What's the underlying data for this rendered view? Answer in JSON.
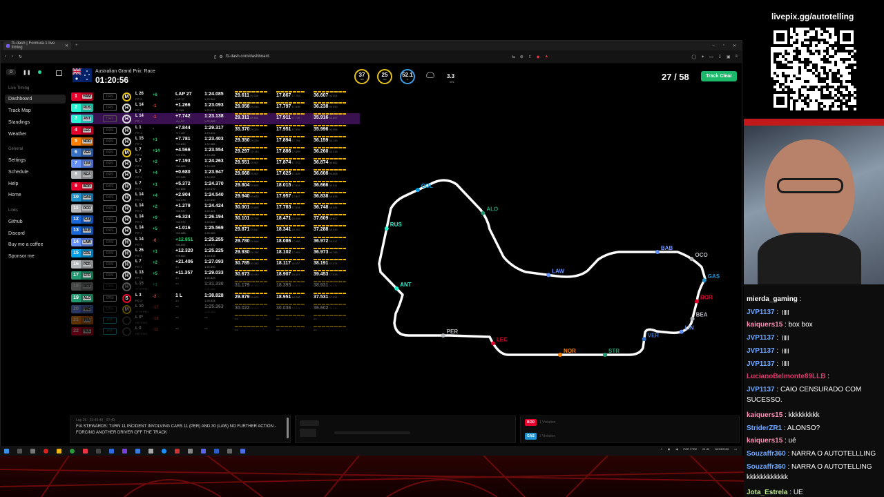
{
  "browser": {
    "tab_title": "f1-dash | Formula 1 live timing",
    "url": "f1-dash.com/dashboard"
  },
  "sidebar": {
    "delay_value": "0",
    "live_timing_heading": "Live Timing",
    "items": [
      "Dashboard",
      "Track Map",
      "Standings",
      "Weather"
    ],
    "general_heading": "General",
    "general_items": [
      "Settings",
      "Schedule",
      "Help",
      "Home"
    ],
    "links_heading": "Links",
    "link_items": [
      "Github",
      "Discord",
      "Buy me a coffee",
      "Sponsor me"
    ]
  },
  "header": {
    "race_name": "Australian Grand Prix: Race",
    "clock": "01:20:56",
    "gauges": [
      {
        "value": "37",
        "label": "TRC",
        "color": "#e6c21a"
      },
      {
        "value": "25",
        "label": "AIR",
        "color": "#e6c21a"
      },
      {
        "value": "52.1",
        "label": "%",
        "color": "#3aa0e8"
      }
    ],
    "wind_speed": "3.3",
    "wind_unit": "m/s",
    "lap_counter": "27 / 58",
    "track_status": "Track Clear"
  },
  "drivers": [
    {
      "pos": "1",
      "tla": "HAM",
      "color": "#e8002d",
      "tyre": "M",
      "tyre_color": "#e6c21a",
      "laps": "L 26",
      "pit": "PIT 0",
      "delta": "+6",
      "delta_color": "#2ecc71",
      "gap": "LAP 27",
      "gap2": "LAP 27",
      "lap": "1:24.085",
      "lap2": "1:23.362",
      "s1": "29.611",
      "s1b": "29.258",
      "s2": "17.867",
      "s2b": "17.753",
      "s3": "36.607",
      "s3b": "36.304"
    },
    {
      "pos": "2",
      "tla": "RUS",
      "color": "#27f4d2",
      "tyre": "H",
      "tyre_color": "#dddddd",
      "laps": "L 14",
      "pit": "PIT 1",
      "delta": "-1",
      "delta_color": "#e74c3c",
      "gap": "+1.266",
      "gap2": "+1.266",
      "lap": "1:23.093",
      "lap2": "1:22.811",
      "s1": "29.058",
      "s1b": "29.015",
      "s2": "17.797",
      "s2b": "17.696",
      "s3": "36.238",
      "s3b": "35.930"
    },
    {
      "pos": "3",
      "tla": "ANT",
      "color": "#27f4d2",
      "tyre": "H",
      "tyre_color": "#dddddd",
      "laps": "L 14",
      "pit": "PIT 1",
      "delta": "-1",
      "delta_color": "#e74c3c",
      "gap": "+7.742",
      "gap2": "+9.123",
      "lap": "1:23.138",
      "lap2": "1:22.596",
      "s1": "29.311",
      "s1b": "28.868",
      "s2": "17.911",
      "s2b": "17.730",
      "s3": "35.916",
      "s3b": "35.857",
      "highlight": true
    },
    {
      "pos": "4",
      "tla": "LEC",
      "color": "#e8002d",
      "tyre": "H",
      "tyre_color": "#dddddd",
      "laps": "L 1",
      "pit": "PIT 1",
      "delta": "-",
      "delta_color": "#aaaaaa",
      "gap": "+7.844",
      "gap2": "+17.167",
      "lap": "1:29.317",
      "lap2": "1:23.322",
      "s1": "35.370",
      "s1b": "29.324",
      "s2": "17.951",
      "s2b": "17.655",
      "s3": "35.996",
      "s3b": "35.996"
    },
    {
      "pos": "5",
      "tla": "NOR",
      "color": "#ff8000",
      "tyre": "H",
      "tyre_color": "#dddddd",
      "laps": "L 15",
      "pit": "PIT 1",
      "delta": "+1",
      "delta_color": "#2ecc71",
      "gap": "+7.781",
      "gap2": "+24.830",
      "lap": "1:23.403",
      "lap2": "1:22.986",
      "s1": "29.350",
      "s1b": "29.254",
      "s2": "17.894",
      "s2b": "17.764",
      "s3": "36.159",
      "s3b": "36.159"
    },
    {
      "pos": "6",
      "tla": "VER",
      "color": "#3671c6",
      "tyre": "M",
      "tyre_color": "#e6c21a",
      "laps": "L 7",
      "pit": "PIT 1",
      "delta": "+14",
      "delta_color": "#2ecc71",
      "gap": "+4.566",
      "gap2": "+29.373",
      "lap": "1:23.554",
      "lap2": "1:23.456",
      "s1": "29.297",
      "s1b": "29.143",
      "s2": "17.886",
      "s2b": "17.609",
      "s3": "36.260",
      "s3b": "36.018"
    },
    {
      "pos": "7",
      "tla": "LIN",
      "color": "#6692ff",
      "tyre": "H",
      "tyre_color": "#dddddd",
      "laps": "L 7",
      "pit": "PIT 1",
      "delta": "+2",
      "delta_color": "#2ecc71",
      "gap": "+7.193",
      "gap2": "+36.666",
      "lap": "1:24.263",
      "lap2": "1:24.182",
      "s1": "29.551",
      "s1b": "29.507",
      "s2": "17.874",
      "s2b": "17.713",
      "s3": "36.874",
      "s3b": "36.862"
    },
    {
      "pos": "8",
      "tla": "BEA",
      "color": "#b6babd",
      "tyre": "H",
      "tyre_color": "#dddddd",
      "laps": "L 7",
      "pit": "PIT 1",
      "delta": "+4",
      "delta_color": "#2ecc71",
      "gap": "+0.680",
      "gap2": "+37.346",
      "lap": "1:23.947",
      "lap2": "1:24.020",
      "s1": "29.668",
      "s1b": "29.507",
      "s2": "17.625",
      "s2b": "17.625",
      "s3": "36.608",
      "s3b": "36.608"
    },
    {
      "pos": "9",
      "tla": "BOR",
      "color": "#e8002d",
      "tyre": "H",
      "tyre_color": "#dddddd",
      "laps": "L 7",
      "pit": "PIT 1",
      "delta": "+1",
      "delta_color": "#2ecc71",
      "gap": "+5.372",
      "gap2": "+42.898",
      "lap": "1:24.370",
      "lap2": "1:24.370",
      "s1": "29.804",
      "s1b": "29.685",
      "s2": "18.015",
      "s2b": "17.824",
      "s3": "36.666",
      "s3b": "36.511"
    },
    {
      "pos": "10",
      "tla": "GAS",
      "color": "#2293d1",
      "tyre": "H",
      "tyre_color": "#dddddd",
      "laps": "L 14",
      "pit": "PIT 1",
      "delta": "+4",
      "delta_color": "#2ecc71",
      "gap": "+2.904",
      "gap2": "+45.375",
      "lap": "1:24.540",
      "lap2": "1:24.540",
      "s1": "29.940",
      "s1b": "29.633",
      "s2": "17.957",
      "s2b": "17.847",
      "s3": "36.838",
      "s3b": "36.838"
    },
    {
      "pos": "11",
      "tla": "OCO",
      "color": "#b6babd",
      "tyre": "H",
      "tyre_color": "#dddddd",
      "laps": "L 14",
      "pit": "PIT 1",
      "delta": "+2",
      "delta_color": "#2ecc71",
      "gap": "+1.279",
      "gap2": "+46.537",
      "lap": "1:24.424",
      "lap2": "1:24.424",
      "s1": "30.001",
      "s1b": "29.889",
      "s2": "17.783",
      "s2b": "17.634",
      "s3": "36.748",
      "s3b": "36.354"
    },
    {
      "pos": "12",
      "tla": "SAI",
      "color": "#1868db",
      "tyre": "H",
      "tyre_color": "#dddddd",
      "laps": "L 14",
      "pit": "PIT 1",
      "delta": "+9",
      "delta_color": "#2ecc71",
      "gap": "+6.324",
      "gap2": "+52.972",
      "lap": "1:26.194",
      "lap2": "1:24.824",
      "s1": "30.101",
      "s1b": "29.765",
      "s2": "18.471",
      "s2b": "18.048",
      "s3": "37.609",
      "s3b": "36.842"
    },
    {
      "pos": "13",
      "tla": "ALB",
      "color": "#1868db",
      "tyre": "H",
      "tyre_color": "#dddddd",
      "laps": "L 14",
      "pit": "PIT 1",
      "delta": "+5",
      "delta_color": "#2ecc71",
      "gap": "+1.016",
      "gap2": "+53.988",
      "lap": "1:25.569",
      "lap2": "1:25.069",
      "s1": "29.871",
      "s1b": "29.647",
      "s2": "18.341",
      "s2b": "18.153",
      "s3": "37.288",
      "s3b": "36.949"
    },
    {
      "pos": "14",
      "tla": "LAW",
      "color": "#6692ff",
      "tyre": "H",
      "tyre_color": "#dddddd",
      "laps": "L 14",
      "pit": "PIT 1",
      "delta": "-6",
      "delta_color": "#e74c3c",
      "gap": "+12.851",
      "gap2": "+66.892",
      "lap": "1:25.255",
      "lap2": "1:24.910",
      "s1": "29.780",
      "s1b": "29.568",
      "s2": "18.086",
      "s2b": "17.908",
      "s3": "36.972",
      "s3b": "36.917"
    },
    {
      "pos": "15",
      "tla": "COL",
      "color": "#00a1e8",
      "tyre": "H",
      "tyre_color": "#dddddd",
      "laps": "L 25",
      "pit": "PIT 1",
      "delta": "+1",
      "delta_color": "#2ecc71",
      "gap": "+12.320",
      "gap2": "+78.952",
      "lap": "1:25.225",
      "lap2": "1:24.918",
      "s1": "29.930",
      "s1b": "29.764",
      "s2": "18.102",
      "s2b": "17.902",
      "s3": "36.973",
      "s3b": "36.783"
    },
    {
      "pos": "16",
      "tla": "PER",
      "color": "#b6babd",
      "tyre": "H",
      "tyre_color": "#dddddd",
      "laps": "L 7",
      "pit": "PIT 1",
      "delta": "+2",
      "delta_color": "#2ecc71",
      "gap": "+21.406",
      "gap2": "1 L",
      "lap": "1:27.093",
      "lap2": "1:26.490",
      "s1": "30.785",
      "s1b": "30.362",
      "s2": "18.117",
      "s2b": "18.037",
      "s3": "38.191",
      "s3b": "37.474"
    },
    {
      "pos": "17",
      "tla": "STR",
      "color": "#229971",
      "tyre": "H",
      "tyre_color": "#dddddd",
      "laps": "L 13",
      "pit": "PIT 1",
      "delta": "+5",
      "delta_color": "#2ecc71",
      "gap": "+11.357",
      "gap2": "1 L",
      "lap": "1:29.033",
      "lap2": "1:26.825",
      "s1": "30.673",
      "s1b": "30.414",
      "s2": "18.907",
      "s2b": "18.467",
      "s3": "39.453",
      "s3b": "37.533"
    },
    {
      "pos": "18",
      "tla": "BOT",
      "color": "#b6babd",
      "tyre": "H",
      "tyre_color": "#dddddd",
      "laps": "L 15",
      "pit": "STOPPED",
      "delta": "+1",
      "delta_color": "#2ecc71",
      "gap": "--",
      "gap2": "",
      "lap": "1:31.330",
      "lap2": "1:31.330",
      "s1": "31.179",
      "s1b": "31.179",
      "s2": "18.393",
      "s2b": "18.393",
      "s3": "38.931",
      "s3b": "38.931",
      "dim": true
    },
    {
      "pos": "19",
      "tla": "ALO",
      "color": "#229971",
      "tyre": "S",
      "tyre_color": "#e8002d",
      "laps": "L 3",
      "pit": "PIT 2",
      "delta": "-2",
      "delta_color": "#e74c3c",
      "gap": "1 L",
      "gap2": "1 L",
      "lap": "1:38.828",
      "lap2": "1:28.828",
      "s1": "29.879",
      "s1b": "29.879",
      "s2": "18.951",
      "s2b": "18.266",
      "s3": "37.531",
      "s3b": "37.531"
    },
    {
      "pos": "20",
      "tla": "HAD",
      "color": "#6692ff",
      "tyre": "M",
      "tyre_color": "#e6c21a",
      "laps": "L 10",
      "pit": "STOPPED",
      "delta": "-17",
      "delta_color": "#e74c3c",
      "gap": "--",
      "gap2": "",
      "lap": "1:25.363",
      "lap2": "1:25.363",
      "s1": "30.022",
      "s1b": "29.957",
      "s2": "30.036",
      "s2b": "18.095",
      "s3": "36.602",
      "s3b": "36.445",
      "dim": true
    },
    {
      "pos": "21",
      "tla": "PIA",
      "color": "#ff8000",
      "tyre": "",
      "tyre_color": "#444444",
      "laps": "L 0*",
      "pit": "RETIRED",
      "delta": "-16",
      "delta_color": "#e74c3c",
      "gap": "--",
      "gap2": "",
      "lap": "--",
      "lap2": "",
      "s1": "--",
      "s1b": "",
      "s2": "--",
      "s2b": "",
      "s3": "--",
      "s3b": "",
      "dim": true,
      "pitlane": true
    },
    {
      "pos": "22",
      "tla": "HUL",
      "color": "#e8002d",
      "tyre": "",
      "tyre_color": "#444444",
      "laps": "L 0",
      "pit": "RETIRED",
      "delta": "-11",
      "delta_color": "#e74c3c",
      "gap": "--",
      "gap2": "",
      "lap": "--",
      "lap2": "",
      "s1": "--",
      "s1b": "",
      "s2": "--",
      "s2b": "",
      "s3": "--",
      "s3b": "",
      "dim": true,
      "pitlane": true
    }
  ],
  "track_labels": [
    {
      "text": "COL",
      "color": "#00a1e8"
    },
    {
      "text": "ALO",
      "color": "#229971"
    },
    {
      "text": "LAW",
      "color": "#6692ff"
    },
    {
      "text": "RUS",
      "color": "#27f4d2"
    },
    {
      "text": "ANT",
      "color": "#27f4d2"
    },
    {
      "text": "PER",
      "color": "#b6babd"
    },
    {
      "text": "LEC",
      "color": "#e8002d"
    },
    {
      "text": "NOR",
      "color": "#ff8000"
    },
    {
      "text": "STR",
      "color": "#229971"
    },
    {
      "text": "VER",
      "color": "#3671c6"
    },
    {
      "text": "LIN",
      "color": "#6692ff"
    },
    {
      "text": "BEA",
      "color": "#b6babd"
    },
    {
      "text": "BAB",
      "color": "#6692ff"
    },
    {
      "text": "OCO",
      "color": "#b6babd"
    },
    {
      "text": "GAS",
      "color": "#2293d1"
    },
    {
      "text": "BOR",
      "color": "#e8002d"
    }
  ],
  "race_control": {
    "time": "Lap 26 · 01:40:49 · 07:40",
    "message": "FIA STEWARDS: TURN 11 INCIDENT INVOLVING CARS 11 (PER) AND 30 (LAW) NO FURTHER ACTION - FORCING ANOTHER DRIVER OFF THE TRACK"
  },
  "violations": [
    {
      "tla": "BOR",
      "color": "#e8002d",
      "text": "1 Violation"
    },
    {
      "tla": "GAS",
      "color": "#2293d1",
      "text": "1 Violation"
    }
  ],
  "taskbar": {
    "lang": "POR PTB2",
    "time": "01:42",
    "date": "06/03/2026"
  },
  "stream": {
    "qr_label": "livepix.gg/autotelling",
    "chat": [
      {
        "user": "mierda_gaming",
        "color": "#ffffff",
        "text": ""
      },
      {
        "user": "JVP1137",
        "color": "#6fa8ff",
        "text": "",
        "badge": true
      },
      {
        "user": "kaiquers15",
        "color": "#ff8fb3",
        "text": "box box"
      },
      {
        "user": "JVP1137",
        "color": "#6fa8ff",
        "text": "",
        "badge": true
      },
      {
        "user": "JVP1137",
        "color": "#6fa8ff",
        "text": "",
        "badge": true
      },
      {
        "user": "JVP1137",
        "color": "#6fa8ff",
        "text": "",
        "badge": true
      },
      {
        "user": "LucianoBelmonte89LLB",
        "color": "#e0396b",
        "text": ""
      },
      {
        "user": "JVP1137",
        "color": "#6fa8ff",
        "text": "CAIO CENSURADO COM SUCESSO."
      },
      {
        "user": "kaiquers15",
        "color": "#ff8fb3",
        "text": "kkkkkkkkk"
      },
      {
        "user": "StriderZR1",
        "color": "#6fa8ff",
        "text": "ALONSO?"
      },
      {
        "user": "kaiquers15",
        "color": "#ff8fb3",
        "text": "ué"
      },
      {
        "user": "Souzaffr360",
        "color": "#6fa8ff",
        "text": "NARRA O AUTOTELLLING"
      },
      {
        "user": "Souzaffr360",
        "color": "#6fa8ff",
        "text": "NARRA O AUTOTELLING kkkkkkkkkkkk"
      },
      {
        "user": "Jota_Estrela",
        "color": "#bfe88a",
        "text": "UE"
      }
    ]
  }
}
